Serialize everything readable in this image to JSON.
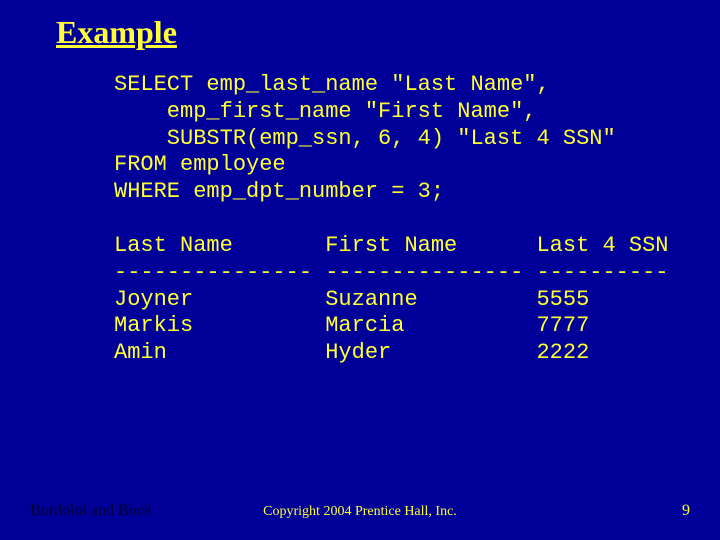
{
  "title": "Example",
  "sql": {
    "line1": "SELECT emp_last_name \"Last Name\",",
    "line2": "    emp_first_name \"First Name\",",
    "line3": "    SUBSTR(emp_ssn, 6, 4) \"Last 4 SSN\"",
    "line4": "FROM employee",
    "line5": "WHERE emp_dpt_number = 3;"
  },
  "result": {
    "header": "Last Name       First Name      Last 4 SSN",
    "divider": "--------------- --------------- ----------",
    "row1": "Joyner          Suzanne         5555",
    "row2": "Markis          Marcia          7777",
    "row3": "Amin            Hyder           2222"
  },
  "footer": {
    "authors": "Bordoloi and Bock",
    "copyright": "Copyright 2004 Prentice Hall, Inc.",
    "page": "9"
  },
  "chart_data": {
    "type": "table",
    "title": "Example",
    "headers": [
      "Last Name",
      "First Name",
      "Last 4 SSN"
    ],
    "rows": [
      [
        "Joyner",
        "Suzanne",
        "5555"
      ],
      [
        "Markis",
        "Marcia",
        "7777"
      ],
      [
        "Amin",
        "Hyder",
        "2222"
      ]
    ],
    "sql_query": "SELECT emp_last_name \"Last Name\", emp_first_name \"First Name\", SUBSTR(emp_ssn, 6, 4) \"Last 4 SSN\" FROM employee WHERE emp_dpt_number = 3;"
  }
}
